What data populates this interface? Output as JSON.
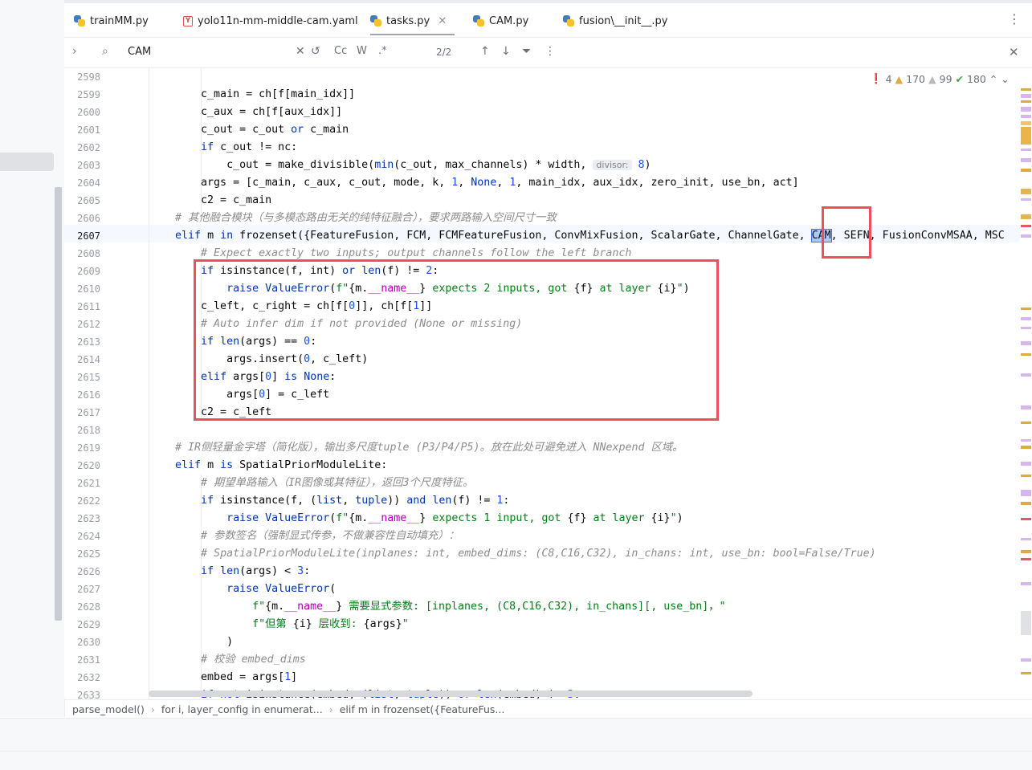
{
  "tabs": [
    {
      "label": "trainMM.py",
      "icon": "python-file-icon"
    },
    {
      "label": "yolo11n-mm-middle-cam.yaml",
      "icon": "yaml-file-icon"
    },
    {
      "label": "tasks.py",
      "icon": "python-file-icon",
      "active": true
    },
    {
      "label": "CAM.py",
      "icon": "python-file-icon"
    },
    {
      "label": "fusion\\__init__.py",
      "icon": "python-file-icon"
    }
  ],
  "search": {
    "query": "CAM",
    "match_case": "Cc",
    "words": "W",
    "regex": ".*",
    "counter": "2/2"
  },
  "inspections": {
    "errors": "4",
    "warnings": "170",
    "weak_warnings": "99",
    "typos": "180"
  },
  "gutter": {
    "lines": [
      "2598",
      "2599",
      "2600",
      "2601",
      "2602",
      "2603",
      "2604",
      "2605",
      "2606",
      "2607",
      "2608",
      "2609",
      "2610",
      "2611",
      "2612",
      "2613",
      "2614",
      "2615",
      "2616",
      "2617",
      "2618",
      "2619",
      "2620",
      "2621",
      "2622",
      "2623",
      "2624",
      "2625",
      "2626",
      "2627",
      "2628",
      "2629",
      "2630",
      "2631",
      "2632",
      "2633"
    ],
    "current": "2607"
  },
  "code_hint": "divisor:",
  "breadcrumb": [
    "parse_model()",
    "for i, layer_config in enumerat...",
    "elif m in frozenset({FeatureFus..."
  ],
  "colors": {
    "keyword": "#0033b3",
    "number": "#1750eb",
    "string": "#067d17",
    "comment": "#8c8c8c",
    "annotation_box": "#ef4f5b",
    "search_match": "#a8caf5"
  }
}
